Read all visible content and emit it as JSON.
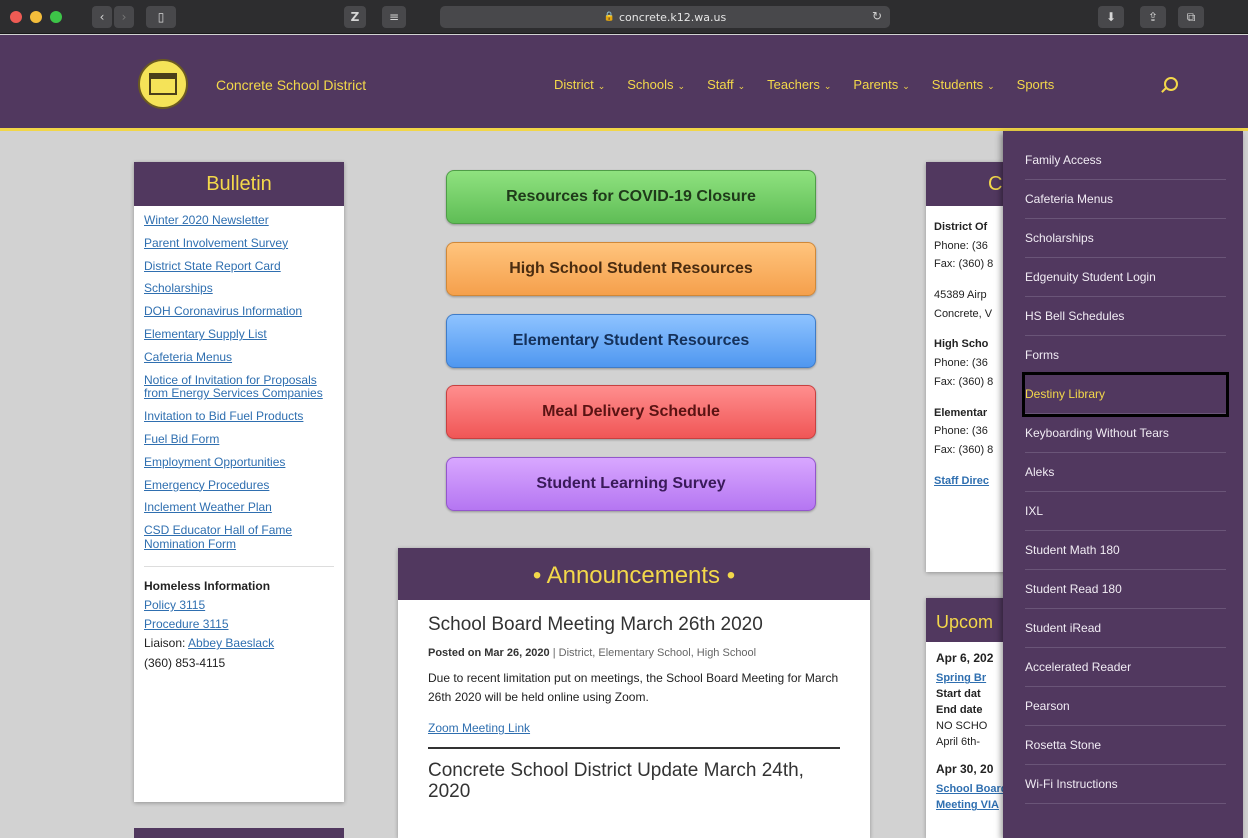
{
  "browser": {
    "url": "concrete.k12.wa.us",
    "reader_label": "Z"
  },
  "site": {
    "brand": "Concrete School District",
    "nav": [
      "District",
      "Schools",
      "Staff",
      "Teachers",
      "Parents",
      "Students",
      "Sports"
    ]
  },
  "bulletin": {
    "title": "Bulletin",
    "links": [
      "Winter 2020 Newsletter",
      "Parent Involvement Survey",
      "District State Report Card",
      "Scholarships",
      "DOH Coronavirus Information",
      "Elementary Supply List",
      "Cafeteria Menus",
      "Notice of Invitation for Proposals from Energy Services Companies",
      "Invitation to Bid Fuel Products",
      "Fuel Bid Form",
      "Employment Opportunities",
      "Emergency Procedures",
      "Inclement Weather Plan",
      "CSD Educator Hall of Fame Nomination Form"
    ],
    "homeless_title": "Homeless Information",
    "policy": "Policy 3115",
    "procedure": "Procedure 3115",
    "liaison_label": "Liaison:",
    "liaison_name": "Abbey Baeslack",
    "phone": "(360) 853-4115"
  },
  "buttons": {
    "covid": "Resources for COVID-19 Closure",
    "hs": "High School Student Resources",
    "elem": "Elementary Student Resources",
    "meal": "Meal Delivery Schedule",
    "survey": "Student Learning Survey"
  },
  "announcements": {
    "title": "• Announcements •",
    "post1_title": "School Board Meeting March 26th 2020",
    "post1_posted": "Posted on Mar 26, 2020",
    "post1_categories": "| District, Elementary School, High School",
    "post1_body": "Due to recent limitation put on meetings, the School Board Meeting for March 26th 2020 will be held online using Zoom.",
    "post1_link": "Zoom Meeting Link",
    "post2_title": "Concrete School District Update March 24th, 2020"
  },
  "contact": {
    "title_fragment": "C",
    "district_label": "District Of",
    "district_phone": "Phone: (36",
    "district_fax": "Fax: (360) 8",
    "addr1": "45389 Airp",
    "addr2": "Concrete, V",
    "hs_label": "High Scho",
    "hs_phone": "Phone: (36",
    "hs_fax": "Fax: (360) 8",
    "elem_label": "Elementar",
    "elem_phone": "Phone: (36",
    "elem_fax": "Fax: (360) 8",
    "staff_link": "Staff Direc"
  },
  "upcoming": {
    "title": "Upcom",
    "date1": "Apr 6, 202",
    "ev1": "Spring Br",
    "start": "Start dat",
    "end": "End date",
    "note1": "NO SCHO",
    "note2": "April 6th-",
    "date2": "Apr 30, 20",
    "ev2": "School Board Meeting VIA"
  },
  "dropdown": {
    "items": [
      "Family Access",
      "Cafeteria Menus",
      "Scholarships",
      "Edgenuity Student Login",
      "HS Bell Schedules",
      "Forms",
      "Destiny Library",
      "Keyboarding Without Tears",
      "Aleks",
      "IXL",
      "Student Math 180",
      "Student Read 180",
      "Student iRead",
      "Accelerated Reader",
      "Pearson",
      "Rosetta Stone",
      "Wi-Fi Instructions"
    ],
    "highlighted": "Destiny Library"
  }
}
